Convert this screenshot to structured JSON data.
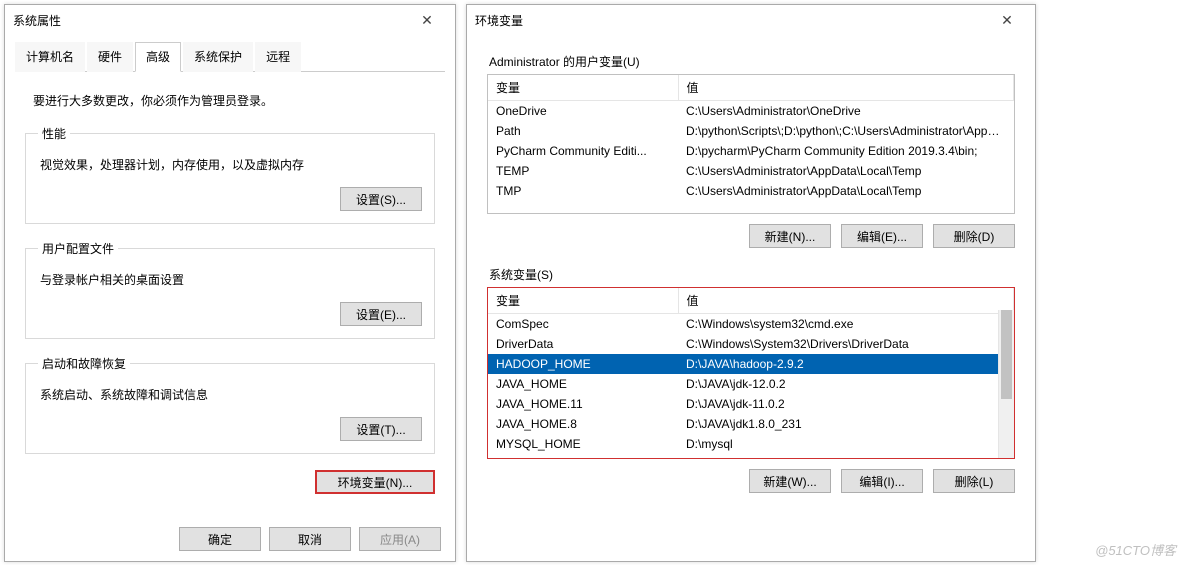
{
  "sys_props": {
    "title": "系统属性",
    "tabs": [
      "计算机名",
      "硬件",
      "高级",
      "系统保护",
      "远程"
    ],
    "active_tab": 2,
    "note": "要进行大多数更改，你必须作为管理员登录。",
    "groups": {
      "perf": {
        "legend": "性能",
        "desc": "视觉效果，处理器计划，内存使用，以及虚拟内存",
        "btn": "设置(S)..."
      },
      "profiles": {
        "legend": "用户配置文件",
        "desc": "与登录帐户相关的桌面设置",
        "btn": "设置(E)..."
      },
      "startup": {
        "legend": "启动和故障恢复",
        "desc": "系统启动、系统故障和调试信息",
        "btn": "设置(T)..."
      }
    },
    "env_btn": "环境变量(N)...",
    "ok": "确定",
    "cancel": "取消",
    "apply": "应用(A)"
  },
  "env": {
    "title": "环境变量",
    "user_section": "Administrator 的用户变量(U)",
    "sys_section": "系统变量(S)",
    "col_var": "变量",
    "col_val": "值",
    "user_vars": [
      {
        "name": "OneDrive",
        "value": "C:\\Users\\Administrator\\OneDrive"
      },
      {
        "name": "Path",
        "value": "D:\\python\\Scripts\\;D:\\python\\;C:\\Users\\Administrator\\AppDat..."
      },
      {
        "name": "PyCharm Community Editi...",
        "value": "D:\\pycharm\\PyCharm Community Edition 2019.3.4\\bin;"
      },
      {
        "name": "TEMP",
        "value": "C:\\Users\\Administrator\\AppData\\Local\\Temp"
      },
      {
        "name": "TMP",
        "value": "C:\\Users\\Administrator\\AppData\\Local\\Temp"
      }
    ],
    "sys_vars": [
      {
        "name": "ComSpec",
        "value": "C:\\Windows\\system32\\cmd.exe"
      },
      {
        "name": "DriverData",
        "value": "C:\\Windows\\System32\\Drivers\\DriverData"
      },
      {
        "name": "HADOOP_HOME",
        "value": "D:\\JAVA\\hadoop-2.9.2",
        "selected": true
      },
      {
        "name": "JAVA_HOME",
        "value": "D:\\JAVA\\jdk-12.0.2"
      },
      {
        "name": "JAVA_HOME.11",
        "value": "D:\\JAVA\\jdk-11.0.2"
      },
      {
        "name": "JAVA_HOME.8",
        "value": "D:\\JAVA\\jdk1.8.0_231"
      },
      {
        "name": "MYSQL_HOME",
        "value": "D:\\mysql"
      }
    ],
    "new_btn": "新建(N)...",
    "edit_btn": "编辑(E)...",
    "del_btn": "删除(D)",
    "new_btn2": "新建(W)...",
    "edit_btn2": "编辑(I)...",
    "del_btn2": "删除(L)"
  },
  "watermark": "@51CTO博客"
}
